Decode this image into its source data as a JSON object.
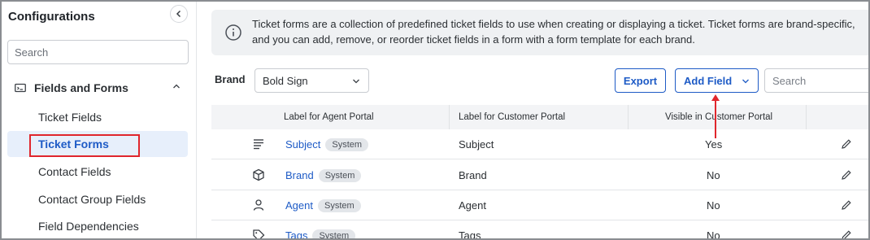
{
  "sidebar": {
    "title": "Configurations",
    "search_placeholder": "Search",
    "group": {
      "label": "Fields and Forms"
    },
    "items": [
      {
        "label": "Ticket Fields"
      },
      {
        "label": "Ticket Forms"
      },
      {
        "label": "Contact Fields"
      },
      {
        "label": "Contact Group Fields"
      },
      {
        "label": "Field Dependencies"
      }
    ]
  },
  "banner": {
    "line1": "Ticket forms are a collection of predefined ticket fields to use when creating or displaying a ticket. Ticket forms are brand-specific,",
    "line2": "and you can add, remove, or reorder ticket fields in a form with a form template for each brand."
  },
  "toolbar": {
    "brand_label": "Brand",
    "brand_value": "Bold Sign",
    "export_label": "Export",
    "add_field_label": "Add Field",
    "search_placeholder": "Search"
  },
  "table": {
    "headers": [
      "Label for Agent Portal",
      "Label for Customer Portal",
      "Visible in Customer Portal"
    ],
    "badge": "System",
    "rows": [
      {
        "icon": "text-lines-icon",
        "agent": "Subject",
        "customer": "Subject",
        "visible": "Yes"
      },
      {
        "icon": "cube-icon",
        "agent": "Brand",
        "customer": "Brand",
        "visible": "No"
      },
      {
        "icon": "person-icon",
        "agent": "Agent",
        "customer": "Agent",
        "visible": "No"
      },
      {
        "icon": "tag-icon",
        "agent": "Tags",
        "customer": "Tags",
        "visible": "No"
      }
    ]
  },
  "colors": {
    "accent": "#1e5bc6",
    "highlight_box": "#e0262d",
    "arrow": "#e0262d"
  }
}
